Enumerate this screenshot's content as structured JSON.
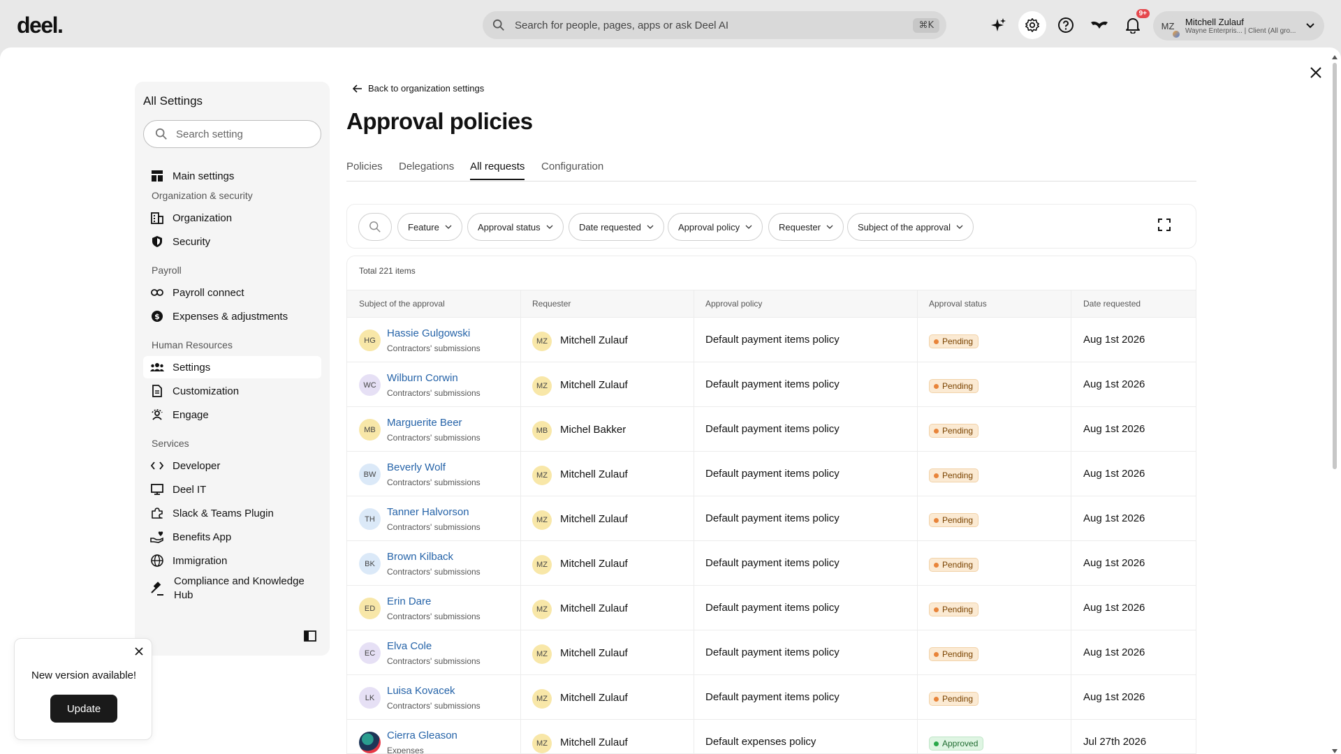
{
  "topbar": {
    "logo": "deel.",
    "search_placeholder": "Search for people, pages, apps or ask Deel AI",
    "search_shortcut": "⌘K",
    "notification_count": "9+",
    "user": {
      "initials": "MZ",
      "name": "Mitchell Zulauf",
      "subtitle": "Wayne Enterpris... | Client (All gro..."
    }
  },
  "sidebar": {
    "title": "All Settings",
    "search_placeholder": "Search setting",
    "main_settings": "Main settings",
    "sections": [
      {
        "label": "Organization & security",
        "items": [
          "Organization",
          "Security"
        ]
      },
      {
        "label": "Payroll",
        "items": [
          "Payroll connect",
          "Expenses & adjustments"
        ]
      },
      {
        "label": "Human Resources",
        "items": [
          "Settings",
          "Customization",
          "Engage"
        ]
      },
      {
        "label": "Services",
        "items": [
          "Developer",
          "Deel IT",
          "Slack & Teams Plugin",
          "Benefits App",
          "Immigration",
          "Compliance and Knowledge Hub"
        ]
      }
    ]
  },
  "toast": {
    "message": "New version available!",
    "button": "Update"
  },
  "content": {
    "back_link": "Back to organization settings",
    "title": "Approval policies",
    "tabs": [
      "Policies",
      "Delegations",
      "All requests",
      "Configuration"
    ],
    "active_tab": "All requests",
    "filters": [
      "Feature",
      "Approval status",
      "Date requested",
      "Approval policy",
      "Requester",
      "Subject of the approval"
    ],
    "total": "Total 221 items",
    "columns": [
      "Subject of the approval",
      "Requester",
      "Approval policy",
      "Approval status",
      "Date requested"
    ],
    "rows": [
      {
        "initials": "HG",
        "name": "Hassie Gulgowski",
        "sub": "Contractors' submissions",
        "req_initials": "MZ",
        "requester": "Mitchell Zulauf",
        "policy": "Default payment items policy",
        "status": "Pending",
        "date": "Aug 1st 2026"
      },
      {
        "initials": "WC",
        "name": "Wilburn Corwin",
        "sub": "Contractors' submissions",
        "req_initials": "MZ",
        "requester": "Mitchell Zulauf",
        "policy": "Default payment items policy",
        "status": "Pending",
        "date": "Aug 1st 2026"
      },
      {
        "initials": "MB",
        "name": "Marguerite Beer",
        "sub": "Contractors' submissions",
        "req_initials": "MB",
        "requester": "Michel Bakker",
        "policy": "Default payment items policy",
        "status": "Pending",
        "date": "Aug 1st 2026"
      },
      {
        "initials": "BW",
        "name": "Beverly Wolf",
        "sub": "Contractors' submissions",
        "req_initials": "MZ",
        "requester": "Mitchell Zulauf",
        "policy": "Default payment items policy",
        "status": "Pending",
        "date": "Aug 1st 2026"
      },
      {
        "initials": "TH",
        "name": "Tanner Halvorson",
        "sub": "Contractors' submissions",
        "req_initials": "MZ",
        "requester": "Mitchell Zulauf",
        "policy": "Default payment items policy",
        "status": "Pending",
        "date": "Aug 1st 2026"
      },
      {
        "initials": "BK",
        "name": "Brown Kilback",
        "sub": "Contractors' submissions",
        "req_initials": "MZ",
        "requester": "Mitchell Zulauf",
        "policy": "Default payment items policy",
        "status": "Pending",
        "date": "Aug 1st 2026"
      },
      {
        "initials": "ED",
        "name": "Erin Dare",
        "sub": "Contractors' submissions",
        "req_initials": "MZ",
        "requester": "Mitchell Zulauf",
        "policy": "Default payment items policy",
        "status": "Pending",
        "date": "Aug 1st 2026"
      },
      {
        "initials": "EC",
        "name": "Elva Cole",
        "sub": "Contractors' submissions",
        "req_initials": "MZ",
        "requester": "Mitchell Zulauf",
        "policy": "Default payment items policy",
        "status": "Pending",
        "date": "Aug 1st 2026"
      },
      {
        "initials": "LK",
        "name": "Luisa Kovacek",
        "sub": "Contractors' submissions",
        "req_initials": "MZ",
        "requester": "Mitchell Zulauf",
        "policy": "Default payment items policy",
        "status": "Pending",
        "date": "Aug 1st 2026"
      },
      {
        "initials": "",
        "name": "Cierra Gleason",
        "sub": "Expenses",
        "req_initials": "MZ",
        "requester": "Mitchell Zulauf",
        "policy": "Default expenses policy",
        "status": "Approved",
        "date": "Jul 27th 2026"
      }
    ]
  },
  "colors": {
    "link": "#2563a8",
    "pending_bg": "#fbead3",
    "approved_bg": "#dff5e3",
    "avatar_yellow": "#f8e7a8",
    "avatar_blue": "#dbe9f8",
    "avatar_purple": "#e6e0f5"
  }
}
